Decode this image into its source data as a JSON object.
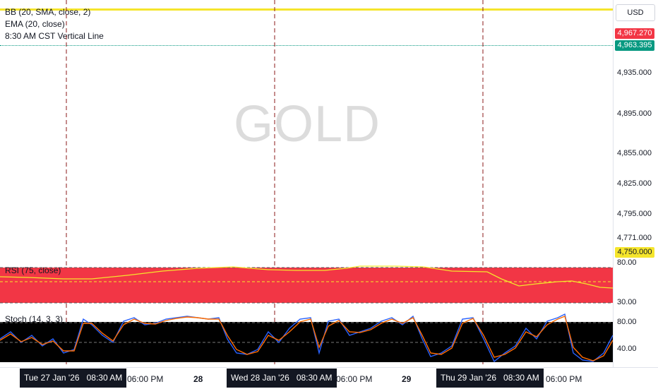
{
  "symbol_watermark": "GOLD",
  "legend": {
    "bb": "BB (20, SMA, close, 2)",
    "ema": "EMA (20, close)",
    "vline": "8:30 AM CST Vertical Line"
  },
  "price_scale": {
    "currency": "USD",
    "ticks": [
      "4,935.000",
      "4,895.000",
      "4,855.000",
      "4,825.000",
      "4,795.000",
      "4,771.000"
    ],
    "tag_red": "4,967.270",
    "tag_green": "4,963.395",
    "tag_yellow": "4,750.000"
  },
  "rsi_pane": {
    "label": "RSI (75, close)",
    "upper": "80.00",
    "lower": "30.00"
  },
  "stoch_pane": {
    "label": "Stoch (14, 3, 3)",
    "upper": "80.00",
    "lower": "40.00"
  },
  "time_axis": {
    "date1": "Tue 27 Jan '26",
    "time1": "08:30 AM",
    "t2": "06:00 PM",
    "t3": "28",
    "date2": "Wed 28 Jan '26",
    "time2": "08:30 AM",
    "t5": "06:00 PM",
    "t6": "29",
    "date3": "Thu 29 Jan '26",
    "time3": "08:30 AM",
    "t8": "06:00 PM"
  },
  "colors": {
    "yellow": "#f5e52c",
    "red_tag": "#f23645",
    "green_tag": "#089981",
    "rsi_fill": "#f23645",
    "stoch_bg": "#000000",
    "stoch_k": "#2962ff",
    "stoch_d": "#ff6d00"
  }
}
